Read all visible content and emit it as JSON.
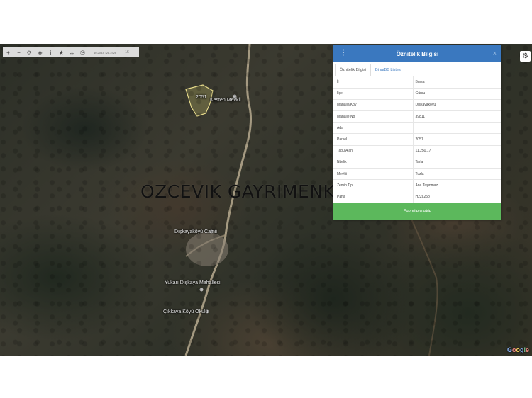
{
  "toolbar": {
    "buttons": [
      {
        "name": "zoom-in-button",
        "glyph": "+"
      },
      {
        "name": "zoom-out-button",
        "glyph": "−"
      },
      {
        "name": "refresh-button",
        "glyph": "⟳"
      },
      {
        "name": "locate-button",
        "glyph": "◈"
      },
      {
        "name": "info-button",
        "glyph": "i"
      },
      {
        "name": "favorite-star-button",
        "glyph": "★"
      },
      {
        "name": "measure-button",
        "glyph": "↔"
      },
      {
        "name": "print-button",
        "glyph": "⎙"
      }
    ],
    "coords": "40.2053 : 28.2426",
    "zoom": "16"
  },
  "settings_icon": "⚙",
  "map": {
    "labels": {
      "parcel": "2051",
      "place1": "Kesten Mevkii",
      "place2": "Dışkayaköyü Camii",
      "place3": "Yukarı Dışkaya Mahallesi",
      "place4": "Çıkkaya Köyü Okulu"
    },
    "google": [
      "G",
      "o",
      "o",
      "g",
      "l",
      "e"
    ]
  },
  "watermark": "OZCEVIK GAYRIMENKUL",
  "panel": {
    "title": "Öznitelik Bilgisi",
    "close": "×",
    "menu": "⋮",
    "tabs": [
      "Öznitelik Bilgisi",
      "Bina/BB Listesi"
    ],
    "rows": [
      {
        "key": "İl",
        "value": "Bursa"
      },
      {
        "key": "İlçe",
        "value": "Gürsu"
      },
      {
        "key": "Mahalle/Köy",
        "value": "Dışkayaköyü"
      },
      {
        "key": "Mahalle No",
        "value": "39811"
      },
      {
        "key": "Ada",
        "value": ""
      },
      {
        "key": "Parsel",
        "value": "2051"
      },
      {
        "key": "Tapu Alanı",
        "value": "11.250,17"
      },
      {
        "key": "Nitelik",
        "value": "Tarla"
      },
      {
        "key": "Mevkii",
        "value": "Tuzla"
      },
      {
        "key": "Zemin Tip",
        "value": "Ana Taşınmaz"
      },
      {
        "key": "Pafta",
        "value": "H22a25b"
      }
    ],
    "fav_button": "Favorilere ekle"
  }
}
